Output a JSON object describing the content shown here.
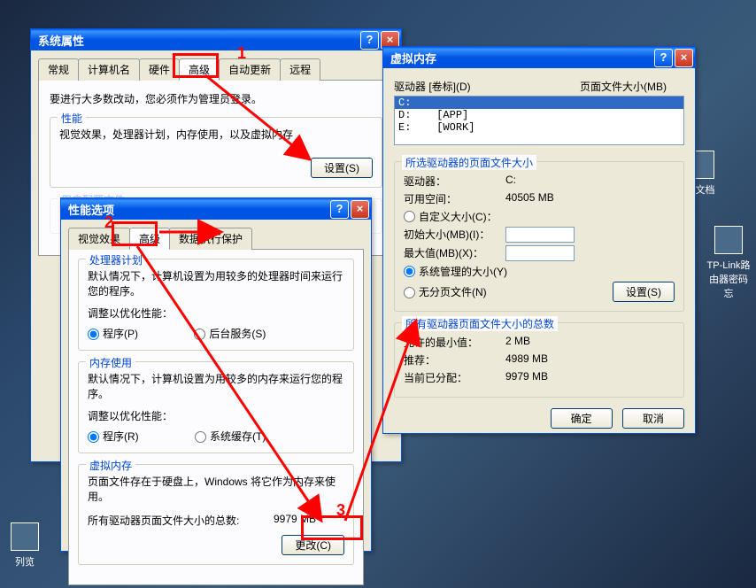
{
  "desktop": {
    "icon1": "本文档",
    "icon2": "TP-Link路由器密码忘",
    "icon3": "列览"
  },
  "win1": {
    "title": "系统属性",
    "tabs": [
      "常规",
      "计算机名",
      "硬件",
      "高级",
      "自动更新",
      "远程"
    ],
    "intro": "要进行大多数改动，您必须作为管理员登录。",
    "perf": {
      "title": "性能",
      "desc": "视觉效果，处理器计划，内存使用，以及虚拟内存",
      "btn": "设置(S)"
    },
    "userprof_title": "用户配置文件"
  },
  "win2": {
    "title": "性能选项",
    "tabs": [
      "视觉效果",
      "高级",
      "数据执行保护"
    ],
    "cpu": {
      "title": "处理器计划",
      "desc": "默认情况下，计算机设置为用较多的处理器时间来运行您的程序。",
      "adjust": "调整以优化性能：",
      "opt1": "程序(P)",
      "opt2": "后台服务(S)"
    },
    "mem": {
      "title": "内存使用",
      "desc": "默认情况下，计算机设置为用较多的内存来运行您的程序。",
      "adjust": "调整以优化性能：",
      "opt1": "程序(R)",
      "opt2": "系统缓存(T)"
    },
    "vm": {
      "title": "虚拟内存",
      "desc": "页面文件存在于硬盘上，Windows 将它作为内存来使用。",
      "total_label": "所有驱动器页面文件大小的总数:",
      "total_value": "9979 MB",
      "btn": "更改(C)"
    }
  },
  "win3": {
    "title": "虚拟内存",
    "list": {
      "h1": "驱动器 [卷标](D)",
      "h2": "页面文件大小(MB)",
      "rows": [
        {
          "drive": "C:",
          "label": "",
          "size": ""
        },
        {
          "drive": "D:",
          "label": "[APP]",
          "size": ""
        },
        {
          "drive": "E:",
          "label": "[WORK]",
          "size": ""
        }
      ]
    },
    "selected": {
      "title": "所选驱动器的页面文件大小",
      "drive_label": "驱动器：",
      "drive_value": "C:",
      "space_label": "可用空间：",
      "space_value": "40505 MB",
      "custom": "自定义大小(C)：",
      "init_label": "初始大小(MB)(I)：",
      "max_label": "最大值(MB)(X)：",
      "sys": "系统管理的大小(Y)",
      "none": "无分页文件(N)",
      "set_btn": "设置(S)"
    },
    "totals": {
      "title": "所有驱动器页面文件大小的总数",
      "min_label": "允许的最小值：",
      "min_value": "2 MB",
      "rec_label": "推荐：",
      "rec_value": "4989 MB",
      "cur_label": "当前已分配：",
      "cur_value": "9979 MB"
    },
    "ok": "确定",
    "cancel": "取消"
  },
  "annotations": {
    "n1": "1",
    "n2": "2",
    "n3": "3"
  }
}
